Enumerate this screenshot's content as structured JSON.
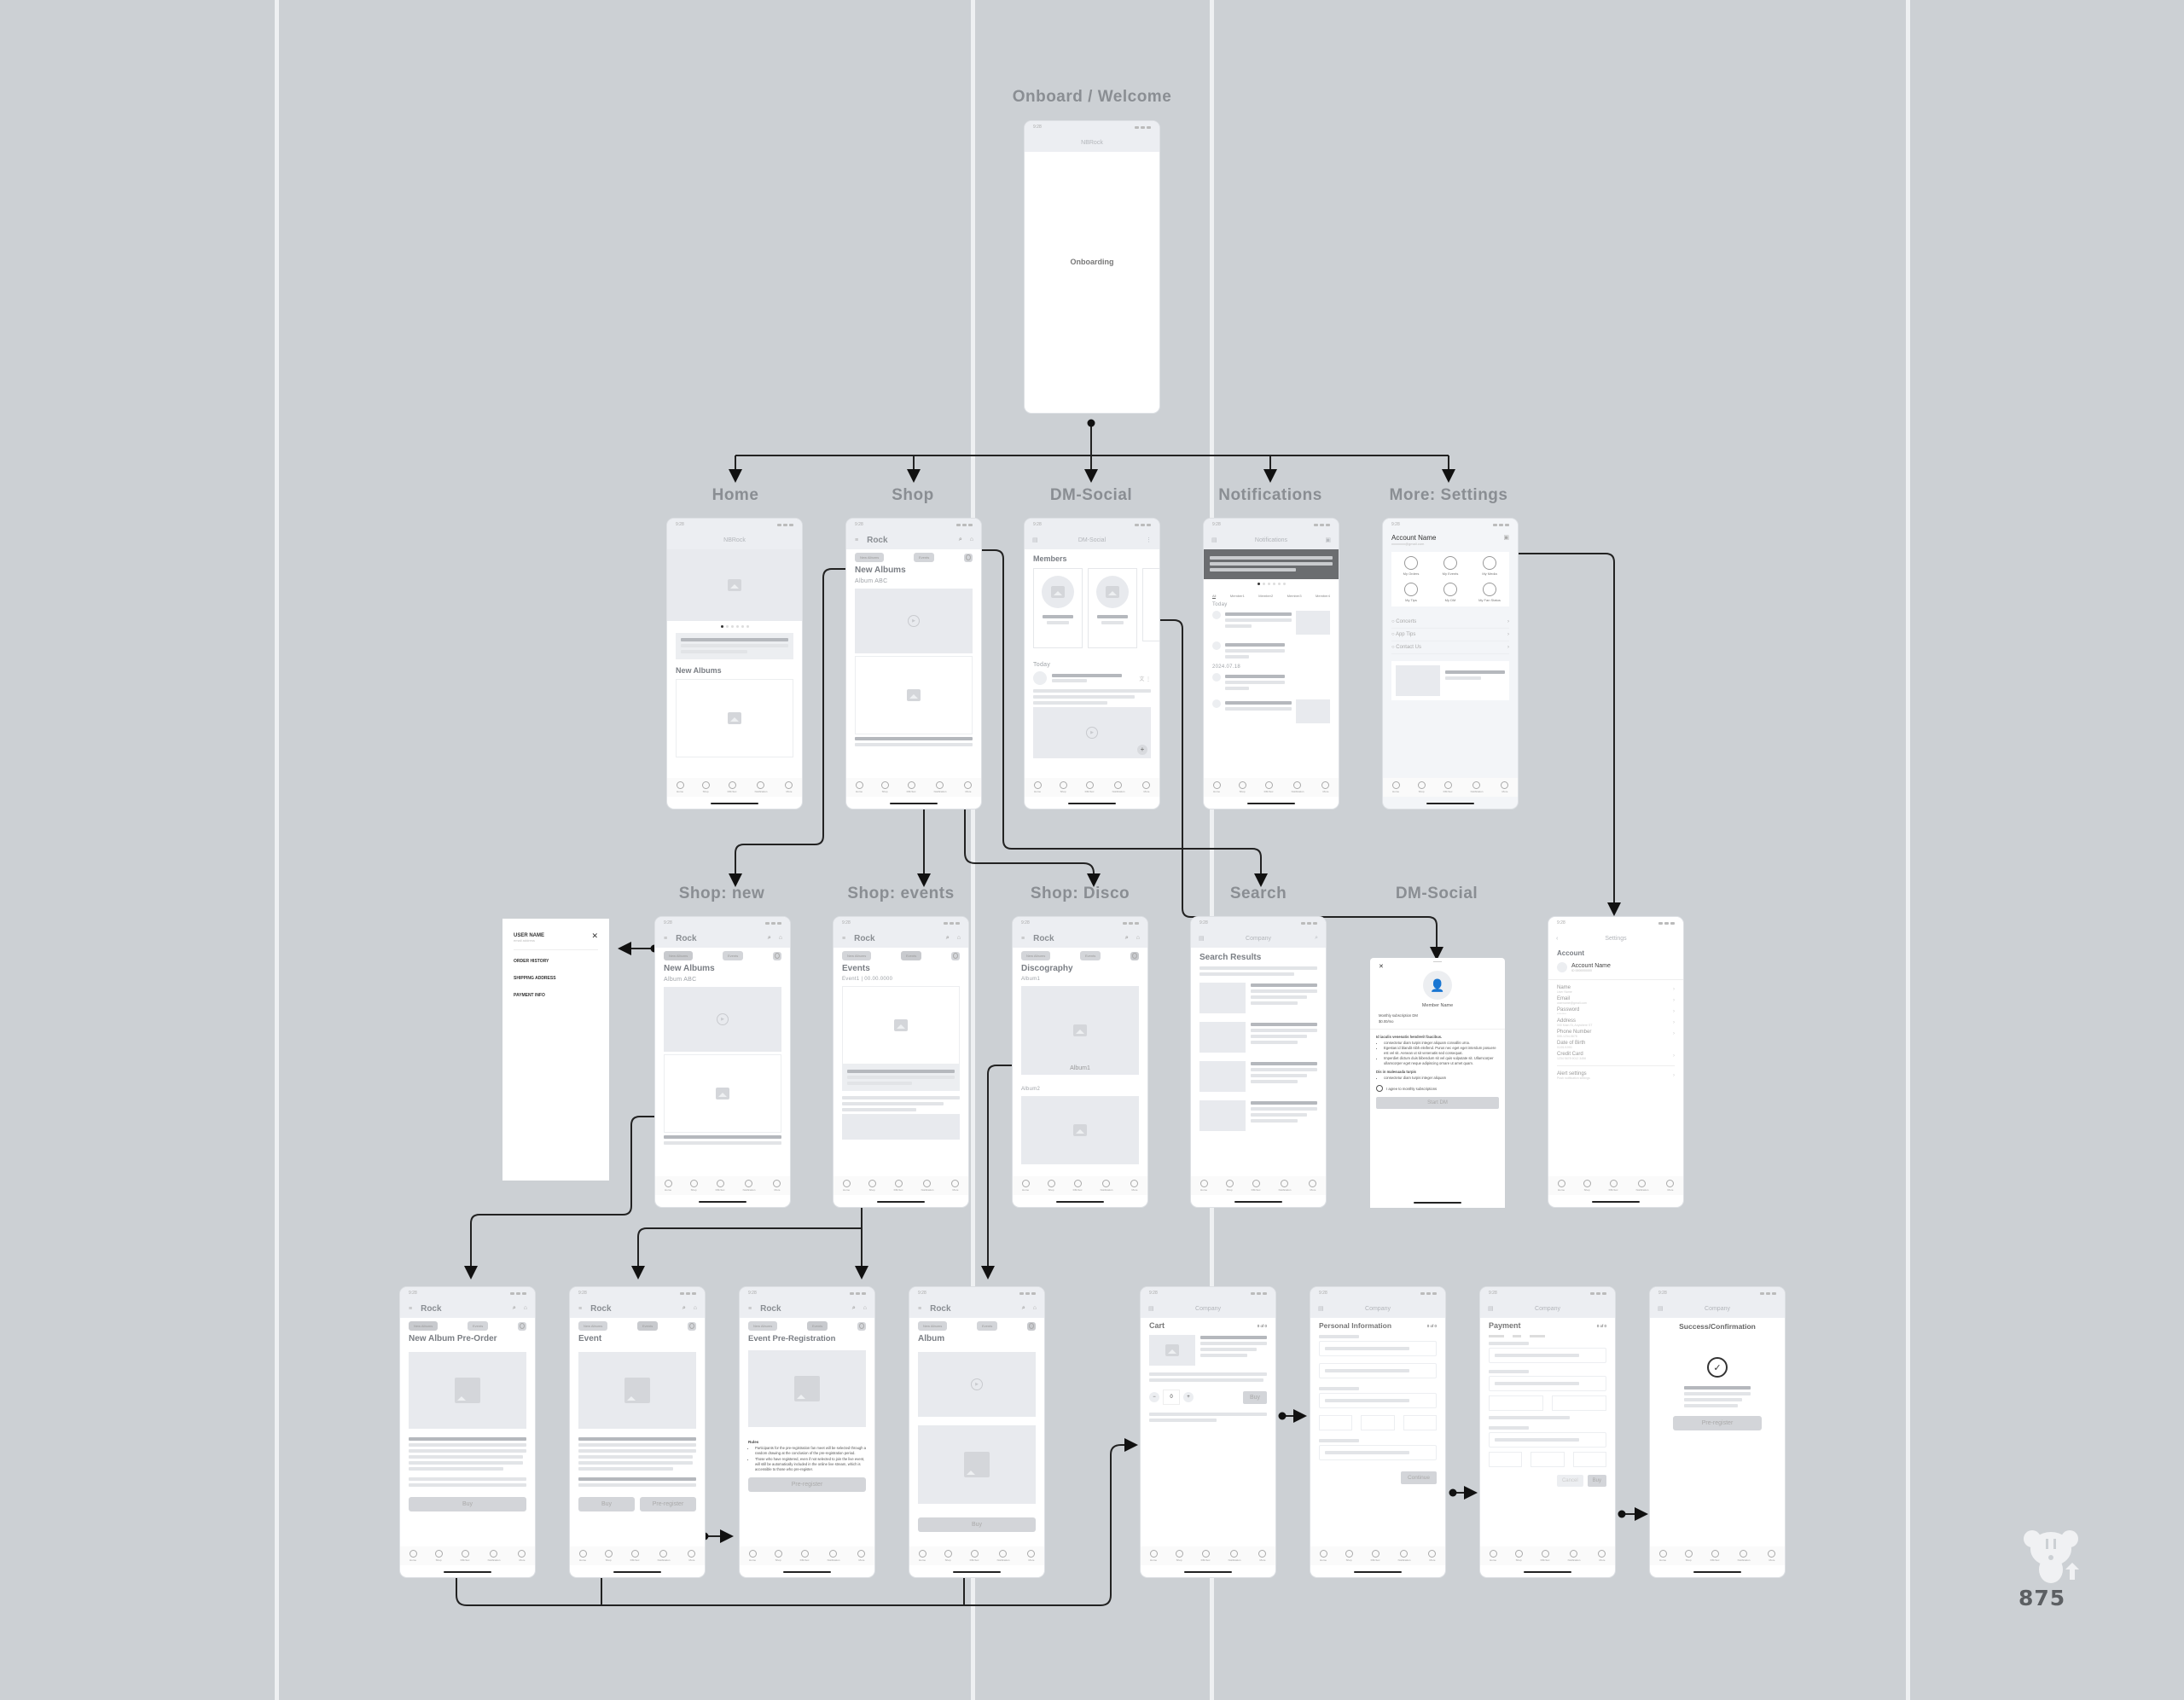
{
  "canvas": {
    "background": "#ccd0d4",
    "stripe_color": "#eef0f2"
  },
  "labels": {
    "onboard": "Onboard / Welcome",
    "home": "Home",
    "shop": "Shop",
    "dm_social": "DM-Social",
    "notifications": "Notifications",
    "more_settings": "More: Settings",
    "shop_new": "Shop: new",
    "shop_events": "Shop: events",
    "shop_disco": "Shop: Disco",
    "search": "Search",
    "dm_social_2": "DM-Social"
  },
  "common": {
    "time": "9:28",
    "app_name": "NBRock",
    "brand": "Rock",
    "company": "Company",
    "pill_new_albums": "New Albums",
    "pill_events": "Events",
    "tabs": [
      "Home",
      "Shop",
      "DM-Soc",
      "Notification",
      "More"
    ]
  },
  "onboarding": {
    "center_text": "Onboarding"
  },
  "home": {
    "section": "New Albums",
    "carousel_pages": 6,
    "carousel_active": 1
  },
  "shop": {
    "title": "New Albums",
    "subtitle": "Album ABC"
  },
  "dm_social": {
    "nav_title": "DM-Social",
    "members_title": "Members",
    "today": "Today"
  },
  "notifications": {
    "nav_title": "Notifications",
    "filters": [
      "All",
      "Member1",
      "Member2",
      "Member3",
      "Member4"
    ],
    "today": "Today",
    "date": "2024.07.18"
  },
  "more": {
    "account_name": "Account Name",
    "email": "xxxxxxxx@gmail.com",
    "grid": [
      "My Orders",
      "My Events",
      "My Media",
      "My Tips",
      "My DM",
      "My Fan Status"
    ],
    "list": [
      "Concerts",
      "App Tips",
      "Contact Us"
    ]
  },
  "drawer": {
    "user_name": "USER NAME",
    "email": "email address",
    "items": [
      "ORDER HISTORY",
      "SHIPPING ADDRESS",
      "PAYMENT INFO"
    ]
  },
  "shop_new": {
    "title": "New Albums",
    "subtitle": "Album ABC"
  },
  "shop_events": {
    "title": "Events",
    "subtitle": "Event1 | 00.00.0000"
  },
  "shop_disco": {
    "title": "Discography",
    "album1": "Album1",
    "album1_caption": "Album1",
    "album2": "Album2"
  },
  "search": {
    "title": "Search Results"
  },
  "dm_modal": {
    "member_name": "Member Name",
    "sub_title": "Monthly subscription DM",
    "price": "$0.00/mo",
    "heading1": "Id iaculis venenatis hendrerit faucibus.",
    "bullets1": [
      "consectetur diam turpis integer aliquam convallis urna.",
      "Egestas id blandit nibh eleifend. Purus nec eget eget interdum posuere est vel sit. Aenean ut sit venenatis sed consequat.",
      "Imperdiet dictum duis bibendum sit vel quis vulputate sit. Ullamcorper ullamcorper eget neque adipiscing ornare ut amet quam."
    ],
    "heading2": "Dis in malesuada turpis",
    "bullets2": [
      "consectetur diam turpis integer aliquam"
    ],
    "agree": "I agree to monthly subscriptions",
    "start": "Start DM"
  },
  "settings": {
    "nav_title": "Settings",
    "title": "Account",
    "account_name": "Account Name",
    "account_id": "ID 0000000000",
    "fields": [
      {
        "label": "Name",
        "value": "User Name"
      },
      {
        "label": "Email",
        "value": "username@gmail.com"
      },
      {
        "label": "Password",
        "value": "********"
      },
      {
        "label": "Address",
        "value": "000 Main St, Anywhere ST"
      },
      {
        "label": "Phone Number",
        "value": "555-1234-5678"
      },
      {
        "label": "Date of Birth",
        "value": "01/01/1990"
      },
      {
        "label": "Credit Card",
        "value": "1234 5678 9012 3456"
      },
      {
        "label": "Alert settings",
        "value": "Push notification settings"
      }
    ]
  },
  "preorder": {
    "title": "New Album Pre-Order",
    "buy": "Buy"
  },
  "event": {
    "title": "Event",
    "buy": "Buy",
    "preregister": "Pre-register"
  },
  "event_prereg": {
    "title": "Event Pre-Registration",
    "rules_title": "Rules",
    "rules": [
      "Participants for the pre-registration fan meet will be selected through a random drawing at the conclusion of the pre-registration period.",
      "Those who have registered, even if not selected to join the live event, will still be automatically included in the online live stream, which is accessible to those who pre-register."
    ],
    "button": "Pre-register"
  },
  "album": {
    "title": "Album",
    "buy": "Buy"
  },
  "cart": {
    "title": "Cart",
    "step": "0 of 0",
    "qty": "0",
    "minus": "−",
    "plus": "+",
    "buy": "Buy"
  },
  "personal": {
    "title": "Personal Information",
    "step": "0 of 0",
    "continue": "Continue"
  },
  "payment": {
    "title": "Payment",
    "step": "0 of 0",
    "cancel": "Cancel",
    "buy": "Buy"
  },
  "success": {
    "title": "Success/Confirmation",
    "button": "Pre-register"
  },
  "logo": {
    "text": "875"
  }
}
